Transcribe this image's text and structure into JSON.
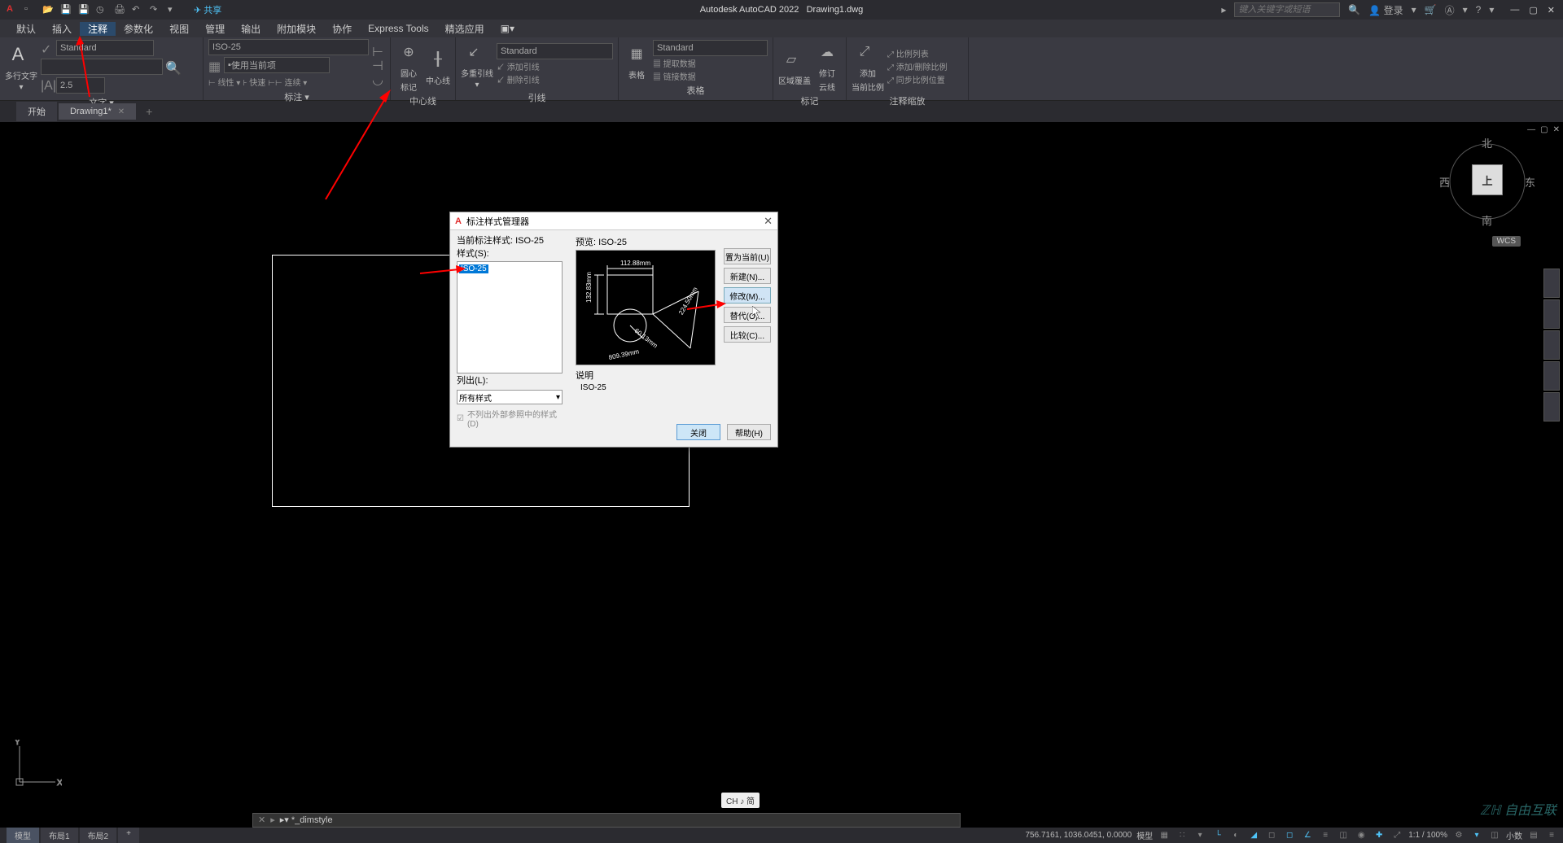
{
  "app": {
    "title_prefix": "Autodesk AutoCAD 2022",
    "document": "Drawing1.dwg",
    "share": "共享",
    "search_placeholder": "键入关键字或短语",
    "login": "登录"
  },
  "menus": [
    "默认",
    "插入",
    "注释",
    "参数化",
    "视图",
    "管理",
    "输出",
    "附加模块",
    "协作",
    "Express Tools",
    "精选应用"
  ],
  "active_menu": 2,
  "ribbon": {
    "text_panel": {
      "big": "A",
      "label": "多行文字",
      "style": "Standard",
      "findbox": "",
      "height": "2.5",
      "title": "文字 ▾"
    },
    "dim_panel": {
      "style": "ISO-25",
      "use_current": "使用当前项",
      "linear": "线性",
      "quick": "快速",
      "continue": "连续",
      "title": "标注 ▾"
    },
    "center_panel": {
      "circle": "圆心",
      "centerline": "中心线",
      "mark": "标记",
      "title": "中心线"
    },
    "leader_panel": {
      "style": "Standard",
      "multi": "多重引线",
      "add": "添加引线",
      "remove": "删除引线",
      "title": "引线"
    },
    "table_panel": {
      "style": "Standard",
      "table": "表格",
      "extract": "提取数据",
      "link": "链接数据",
      "title": "表格"
    },
    "mark_panel": {
      "cover": "区域覆盖",
      "revise": "修订",
      "cloud": "云线",
      "title": "标记"
    },
    "annoscale_panel": {
      "add": "添加",
      "curr": "当前比例",
      "list": "比例列表",
      "addscale": "添加/删除比例",
      "sync": "同步比例位置",
      "title": "注释缩放"
    }
  },
  "tabs": {
    "start": "开始",
    "drawing": "Drawing1*"
  },
  "viewcube": {
    "n": "北",
    "s": "南",
    "e": "东",
    "w": "西",
    "top": "上",
    "wcs": "WCS"
  },
  "dialog": {
    "title": "标注样式管理器",
    "current_label": "当前标注样式:",
    "current_value": "ISO-25",
    "styles_label": "样式(S):",
    "styles": [
      "ISO-25"
    ],
    "list_label": "列出(L):",
    "list_value": "所有样式",
    "checkbox": "不列出外部参照中的样式(D)",
    "preview_label": "预览:",
    "preview_value": "ISO-25",
    "desc_label": "说明",
    "desc_value": "ISO-25",
    "btn_setcurrent": "置为当前(U)",
    "btn_new": "新建(N)...",
    "btn_modify": "修改(M)...",
    "btn_override": "替代(O)...",
    "btn_compare": "比较(C)...",
    "btn_close": "关闭",
    "btn_help": "帮助(H)",
    "preview_dims": {
      "top": "112.88mm",
      "left": "132.83mm",
      "diag": "224.50mm",
      "rad": "60.13mm",
      "bot": "809.39mm"
    }
  },
  "command": {
    "text": "▸▾ *_dimstyle"
  },
  "ime": "CH ♪ 简",
  "status": {
    "tabs": [
      "模型",
      "布局1",
      "布局2"
    ],
    "coords": "756.7161, 1036.0451, 0.0000",
    "model_label": "模型",
    "scale": "1:1 / 100%",
    "decimal": "小数"
  },
  "watermark": "自由互联"
}
